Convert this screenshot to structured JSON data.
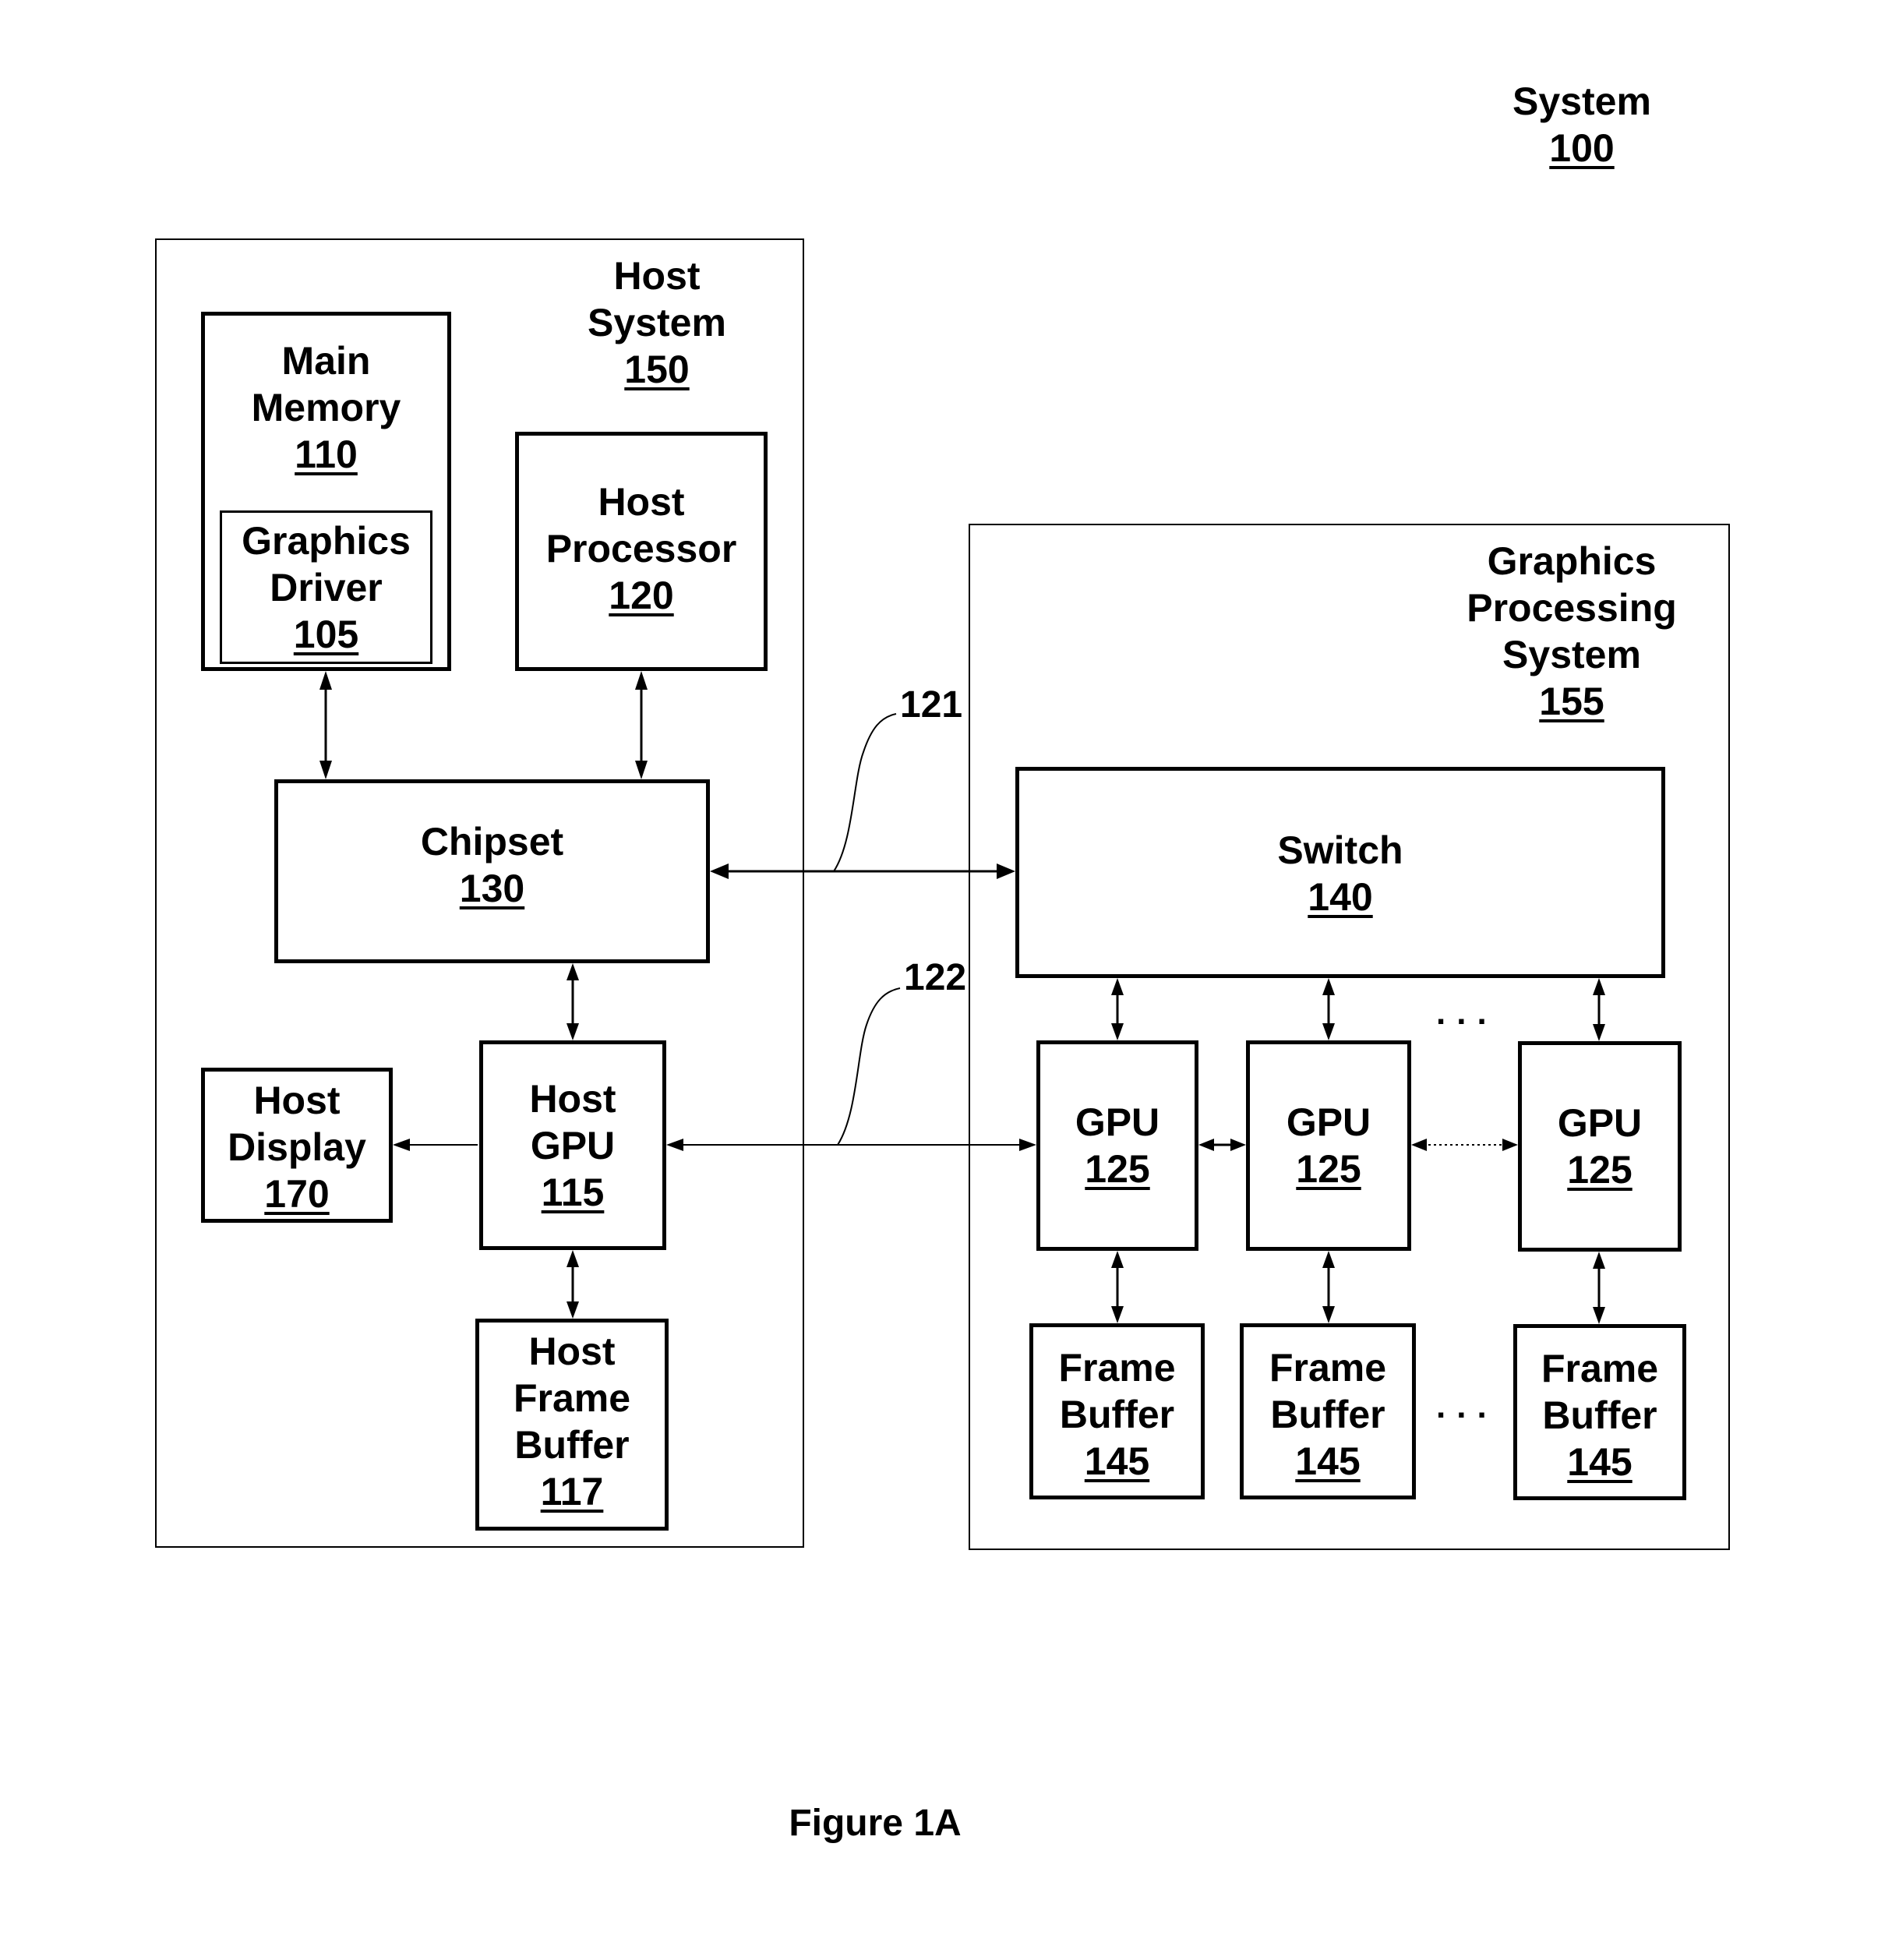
{
  "figure": {
    "caption": "Figure 1A",
    "system": {
      "name": "System",
      "ref": "100"
    },
    "host_system": {
      "name_lines": [
        "Host",
        "System"
      ],
      "ref": "150",
      "blocks": {
        "main_memory": {
          "lines": [
            "Main",
            "Memory"
          ],
          "ref": "110"
        },
        "graphics_driver": {
          "lines": [
            "Graphics",
            "Driver"
          ],
          "ref": "105"
        },
        "host_processor": {
          "lines": [
            "Host",
            "Processor"
          ],
          "ref": "120"
        },
        "chipset": {
          "lines": [
            "Chipset"
          ],
          "ref": "130"
        },
        "host_gpu": {
          "lines": [
            "Host",
            "GPU"
          ],
          "ref": "115"
        },
        "host_display": {
          "lines": [
            "Host",
            "Display"
          ],
          "ref": "170"
        },
        "host_frame_buffer": {
          "lines": [
            "Host",
            "Frame",
            "Buffer"
          ],
          "ref": "117"
        }
      }
    },
    "graphics_processing_system": {
      "name_lines": [
        "Graphics",
        "Processing",
        "System"
      ],
      "ref": "155",
      "switch": {
        "lines": [
          "Switch"
        ],
        "ref": "140"
      },
      "gpus": [
        {
          "lines": [
            "GPU"
          ],
          "ref": "125"
        },
        {
          "lines": [
            "GPU"
          ],
          "ref": "125"
        },
        {
          "lines": [
            "GPU"
          ],
          "ref": "125"
        }
      ],
      "frame_buffers": [
        {
          "lines": [
            "Frame",
            "Buffer"
          ],
          "ref": "145"
        },
        {
          "lines": [
            "Frame",
            "Buffer"
          ],
          "ref": "145"
        },
        {
          "lines": [
            "Frame",
            "Buffer"
          ],
          "ref": "145"
        }
      ],
      "ellipsis": "..."
    },
    "links": {
      "link_121": "121",
      "link_122": "122"
    }
  }
}
